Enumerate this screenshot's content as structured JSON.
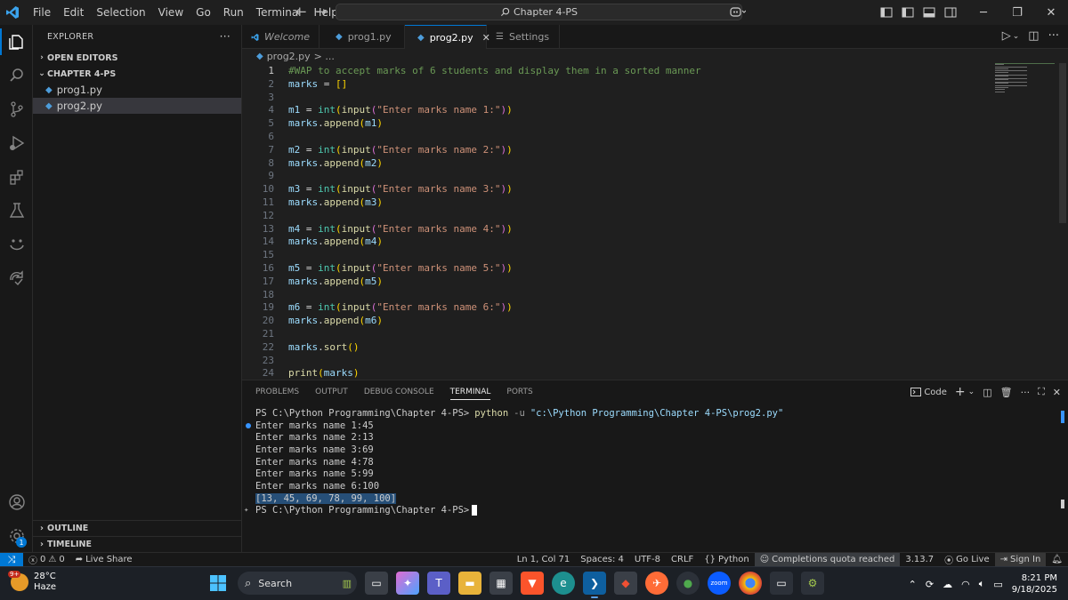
{
  "titlebar": {
    "menu": [
      "File",
      "Edit",
      "Selection",
      "View",
      "Go",
      "Run",
      "Terminal",
      "Help"
    ],
    "search_text": "Chapter 4-PS"
  },
  "sidebar": {
    "title": "EXPLORER",
    "open_editors": "OPEN EDITORS",
    "folder": "CHAPTER 4-PS",
    "files": [
      "prog1.py",
      "prog2.py"
    ],
    "outline": "OUTLINE",
    "timeline": "TIMELINE",
    "accounts_badge": "1"
  },
  "tabs": [
    {
      "label": "Welcome"
    },
    {
      "label": "prog1.py"
    },
    {
      "label": "prog2.py"
    },
    {
      "label": "Settings"
    }
  ],
  "breadcrumb": {
    "file": "prog2.py",
    "rest": "> ..."
  },
  "editor": {
    "lines": [
      "#WAP to accept marks of 6 students and display them in a sorted manner",
      "marks = []",
      "",
      "m1 = int(input(\"Enter marks name 1:\"))",
      "marks.append(m1)",
      "",
      "m2 = int(input(\"Enter marks name 2:\"))",
      "marks.append(m2)",
      "",
      "m3 = int(input(\"Enter marks name 3:\"))",
      "marks.append(m3)",
      "",
      "m4 = int(input(\"Enter marks name 4:\"))",
      "marks.append(m4)",
      "",
      "m5 = int(input(\"Enter marks name 5:\"))",
      "marks.append(m5)",
      "",
      "m6 = int(input(\"Enter marks name 6:\"))",
      "marks.append(m6)",
      "",
      "marks.sort()",
      "",
      "print(marks)"
    ]
  },
  "panel": {
    "tabs": [
      "PROBLEMS",
      "OUTPUT",
      "DEBUG CONSOLE",
      "TERMINAL",
      "PORTS"
    ],
    "active_tab": "TERMINAL",
    "shell_label": "Code",
    "terminal": {
      "prompt": "PS C:\\Python Programming\\Chapter 4-PS>",
      "cmd": "python",
      "flag": "-u",
      "arg": "\"c:\\Python Programming\\Chapter 4-PS\\prog2.py\"",
      "outputs": [
        "Enter marks name 1:45",
        "Enter marks name 2:13",
        "Enter marks name 3:69",
        "Enter marks name 4:78",
        "Enter marks name 5:99",
        "Enter marks name 6:100"
      ],
      "result": "[13, 45, 69, 78, 99, 100]",
      "final_prompt": "PS C:\\Python Programming\\Chapter 4-PS>"
    }
  },
  "statusbar": {
    "errors": "0",
    "warnings": "0",
    "live_share": "Live Share",
    "position": "Ln 1, Col 71",
    "spaces": "Spaces: 4",
    "encoding": "UTF-8",
    "eol": "CRLF",
    "language": "Python",
    "copilot": "Completions quota reached",
    "version": "3.13.7",
    "golive": "Go Live",
    "signin": "Sign In"
  },
  "taskbar": {
    "temp": "28°C",
    "condition": "Haze",
    "weather_badge": "9+",
    "search": "Search",
    "time": "8:21 PM",
    "date": "9/18/2025"
  },
  "colors": {
    "accent": "#0078d4",
    "comment": "#6a9955",
    "string": "#ce9178",
    "function": "#dcdcaa",
    "variable": "#9cdcfe"
  }
}
